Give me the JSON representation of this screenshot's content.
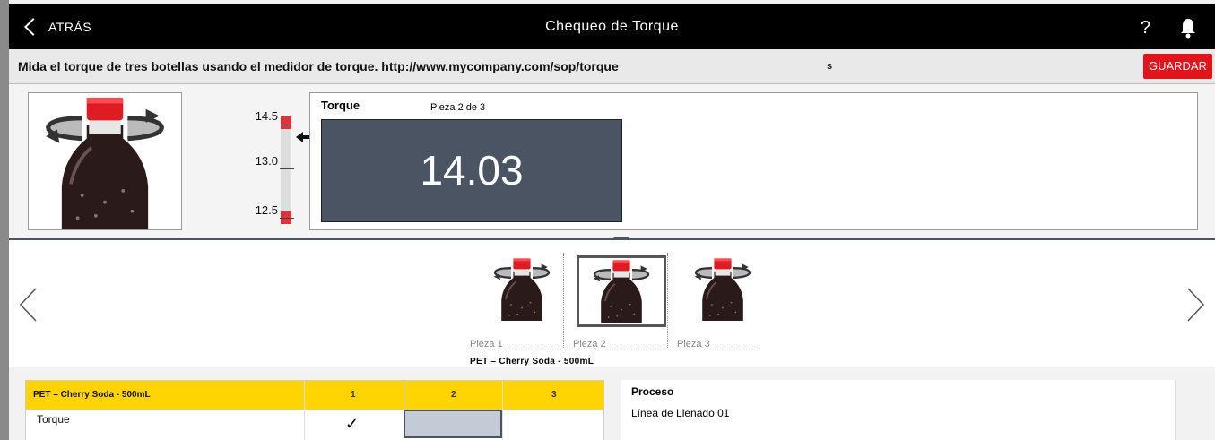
{
  "header": {
    "back_label": "ATRÁS",
    "title": "Chequeo de Torque",
    "help_label": "?"
  },
  "instruction": {
    "text": "Mida el torque de tres botellas usando el medidor de torque.  http://www.mycompany.com/sop/torque",
    "fragment": "s",
    "save_label": "GUARDAR"
  },
  "gauge": {
    "labels": [
      "14.5",
      "13.0",
      "12.5"
    ],
    "current_value": 14.03,
    "min": 12.5,
    "max": 14.5
  },
  "measurement": {
    "label": "Torque",
    "piece_indicator": "Pieza 2 de 3",
    "value": "14.03"
  },
  "carousel": {
    "pieces": [
      {
        "label": "Pieza 1",
        "selected": false
      },
      {
        "label": "Pieza 2",
        "selected": true
      },
      {
        "label": "Pieza 3",
        "selected": false
      }
    ],
    "product_caption": "PET – Cherry Soda - 500mL"
  },
  "grid": {
    "product": "PET – Cherry Soda - 500mL",
    "columns": [
      "1",
      "2",
      "3"
    ],
    "rows": [
      {
        "label": "Torque",
        "cells": [
          "✓",
          "",
          ""
        ]
      }
    ],
    "accent_color": "#ffd400"
  },
  "process": {
    "label": "Proceso",
    "value": "Línea de Llenado 01"
  },
  "colors": {
    "header_bg": "#000000",
    "save_button": "#e3121b",
    "readout_bg": "#4a5462",
    "limit_red": "#e0323c"
  }
}
